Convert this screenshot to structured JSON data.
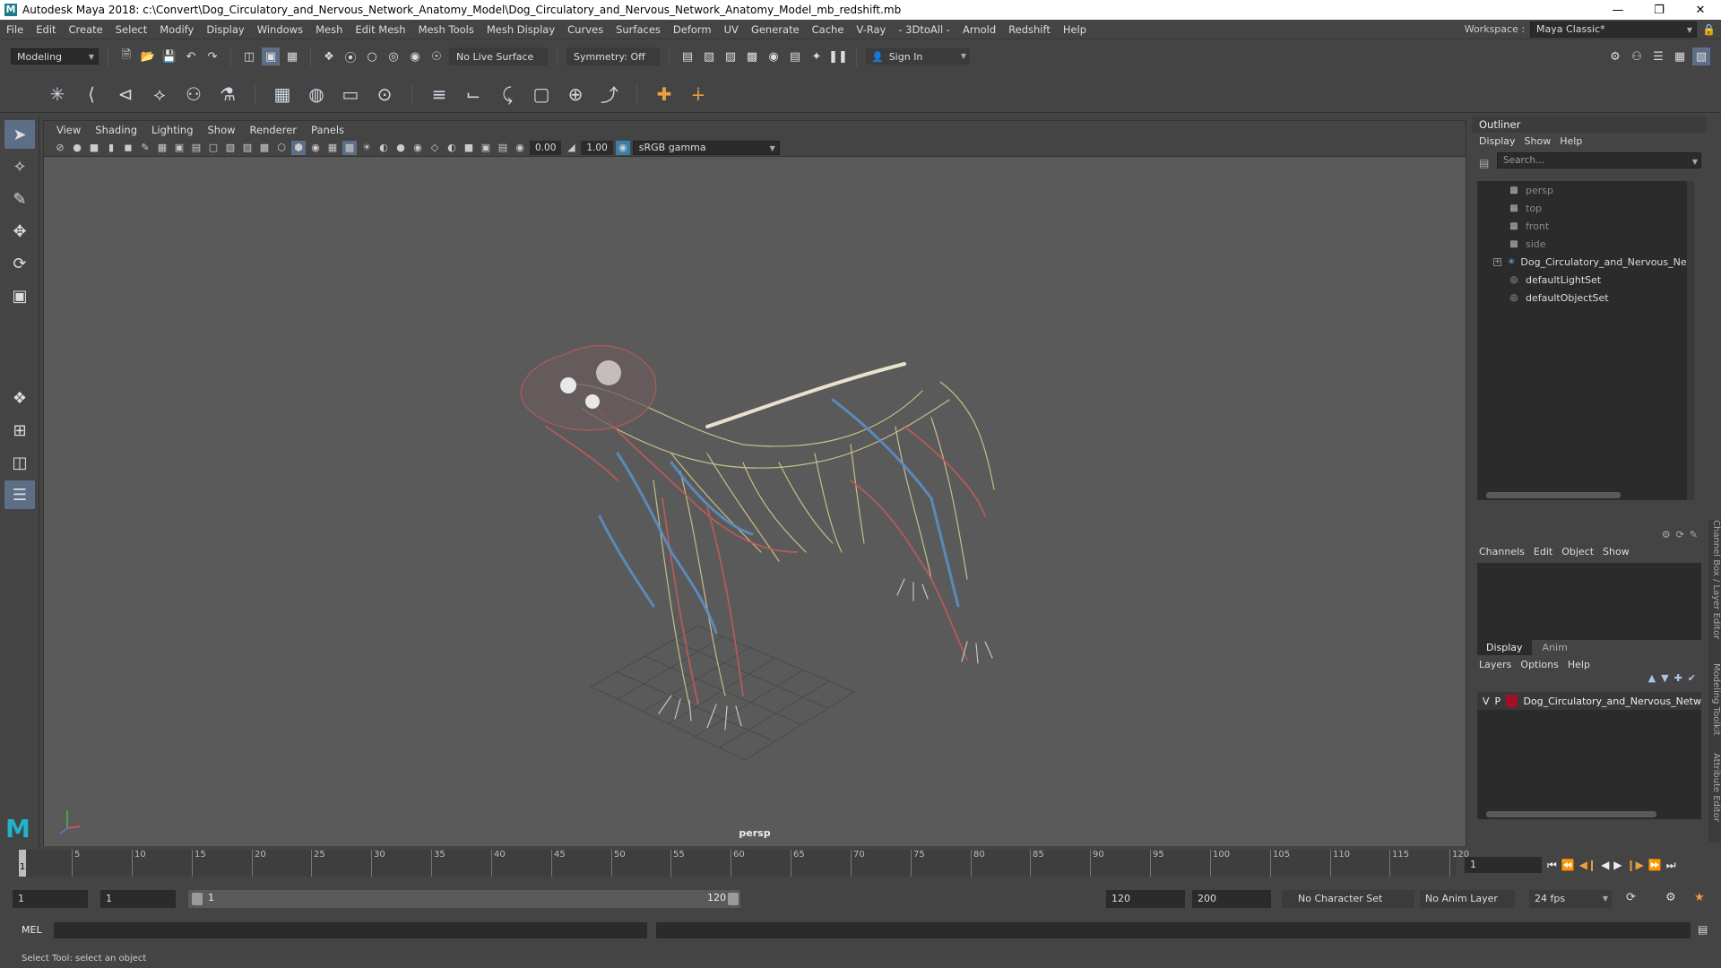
{
  "window": {
    "title": "Autodesk Maya 2018: c:\\Convert\\Dog_Circulatory_and_Nervous_Network_Anatomy_Model\\Dog_Circulatory_and_Nervous_Network_Anatomy_Model_mb_redshift.mb",
    "app_icon": "M"
  },
  "menubar": {
    "items": [
      "File",
      "Edit",
      "Create",
      "Select",
      "Modify",
      "Display",
      "Windows",
      "Mesh",
      "Edit Mesh",
      "Mesh Tools",
      "Mesh Display",
      "Curves",
      "Surfaces",
      "Deform",
      "UV",
      "Generate",
      "Cache",
      "V-Ray",
      "- 3DtoAll -",
      "Arnold",
      "Redshift",
      "Help"
    ],
    "workspace_label": "Workspace :",
    "workspace_value": "Maya Classic*"
  },
  "statusline": {
    "mode": "Modeling",
    "live_surface": "No Live Surface",
    "symmetry": "Symmetry: Off",
    "sign_in": "Sign In"
  },
  "viewport": {
    "menu": [
      "View",
      "Shading",
      "Lighting",
      "Show",
      "Renderer",
      "Panels"
    ],
    "exposure": "0.00",
    "gamma": "1.00",
    "color_space": "sRGB gamma",
    "camera": "persp"
  },
  "outliner": {
    "title": "Outliner",
    "menu": [
      "Display",
      "Show",
      "Help"
    ],
    "search_placeholder": "Search...",
    "items": [
      {
        "label": "persp",
        "icon": "camera-icon",
        "dim": true
      },
      {
        "label": "top",
        "icon": "camera-icon",
        "dim": true
      },
      {
        "label": "front",
        "icon": "camera-icon",
        "dim": true
      },
      {
        "label": "side",
        "icon": "camera-icon",
        "dim": true
      },
      {
        "label": "Dog_Circulatory_and_Nervous_Network_",
        "icon": "transform-icon",
        "dim": false,
        "expandable": true
      },
      {
        "label": "defaultLightSet",
        "icon": "set-icon",
        "dim": false
      },
      {
        "label": "defaultObjectSet",
        "icon": "set-icon",
        "dim": false
      }
    ]
  },
  "channelbox": {
    "menu": [
      "Channels",
      "Edit",
      "Object",
      "Show"
    ]
  },
  "layers": {
    "tabs": [
      "Display",
      "Anim"
    ],
    "menu": [
      "Layers",
      "Options",
      "Help"
    ],
    "rows": [
      {
        "v": "V",
        "p": "P",
        "color": "#a0102a",
        "name": "Dog_Circulatory_and_Nervous_Netw"
      }
    ]
  },
  "side_tabs": [
    "Channel Box / Layer Editor",
    "Modeling Toolkit",
    "Attribute Editor"
  ],
  "timeline": {
    "ticks": [
      "5",
      "10",
      "15",
      "20",
      "25",
      "30",
      "35",
      "40",
      "45",
      "50",
      "55",
      "60",
      "65",
      "70",
      "75",
      "80",
      "85",
      "90",
      "95",
      "100",
      "105",
      "110",
      "115",
      "120"
    ],
    "current_frame": "1",
    "current_frame_field": "1"
  },
  "range": {
    "start": "1",
    "playback_start": "1",
    "slider_start": "1",
    "slider_end": "120",
    "playback_end": "120",
    "end": "200",
    "character_set": "No Character Set",
    "anim_layer": "No Anim Layer",
    "fps": "24 fps"
  },
  "cmdline": {
    "label": "MEL",
    "help": "Select Tool: select an object"
  }
}
